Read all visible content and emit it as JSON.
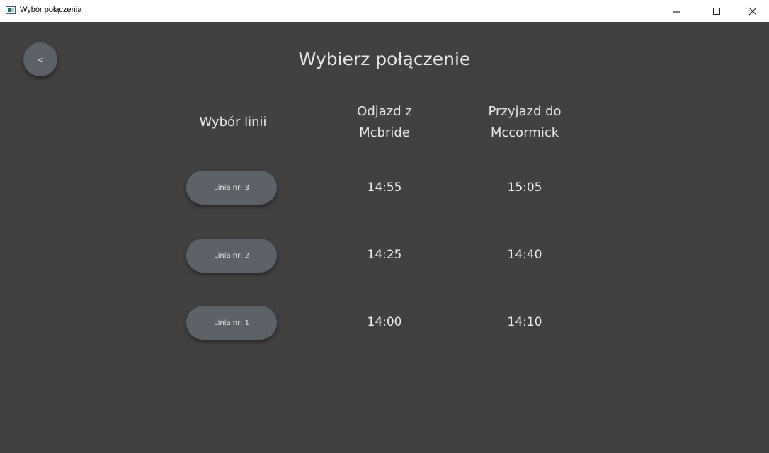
{
  "window": {
    "title": "Wybór połączenia",
    "icon": "app-window-icon",
    "controls": [
      "minimize-icon",
      "maximize-icon",
      "close-icon"
    ]
  },
  "page": {
    "back_label": "<",
    "title": "Wybierz połączenie"
  },
  "headers": {
    "line": "Wybór linii",
    "departure": "Odjazd z\nMcbride",
    "arrival": "Przyjazd do\nMccormick"
  },
  "routes": [
    {
      "button_label": "Linia nr: 3",
      "departure": "14:55",
      "arrival": "15:05"
    },
    {
      "button_label": "Linia nr: 2",
      "departure": "14:25",
      "arrival": "14:40"
    },
    {
      "button_label": "Linia nr: 1",
      "departure": "14:00",
      "arrival": "14:10"
    }
  ],
  "colors": {
    "background": "#414141",
    "button": "#5d6168",
    "text": "#e8e8e8"
  }
}
